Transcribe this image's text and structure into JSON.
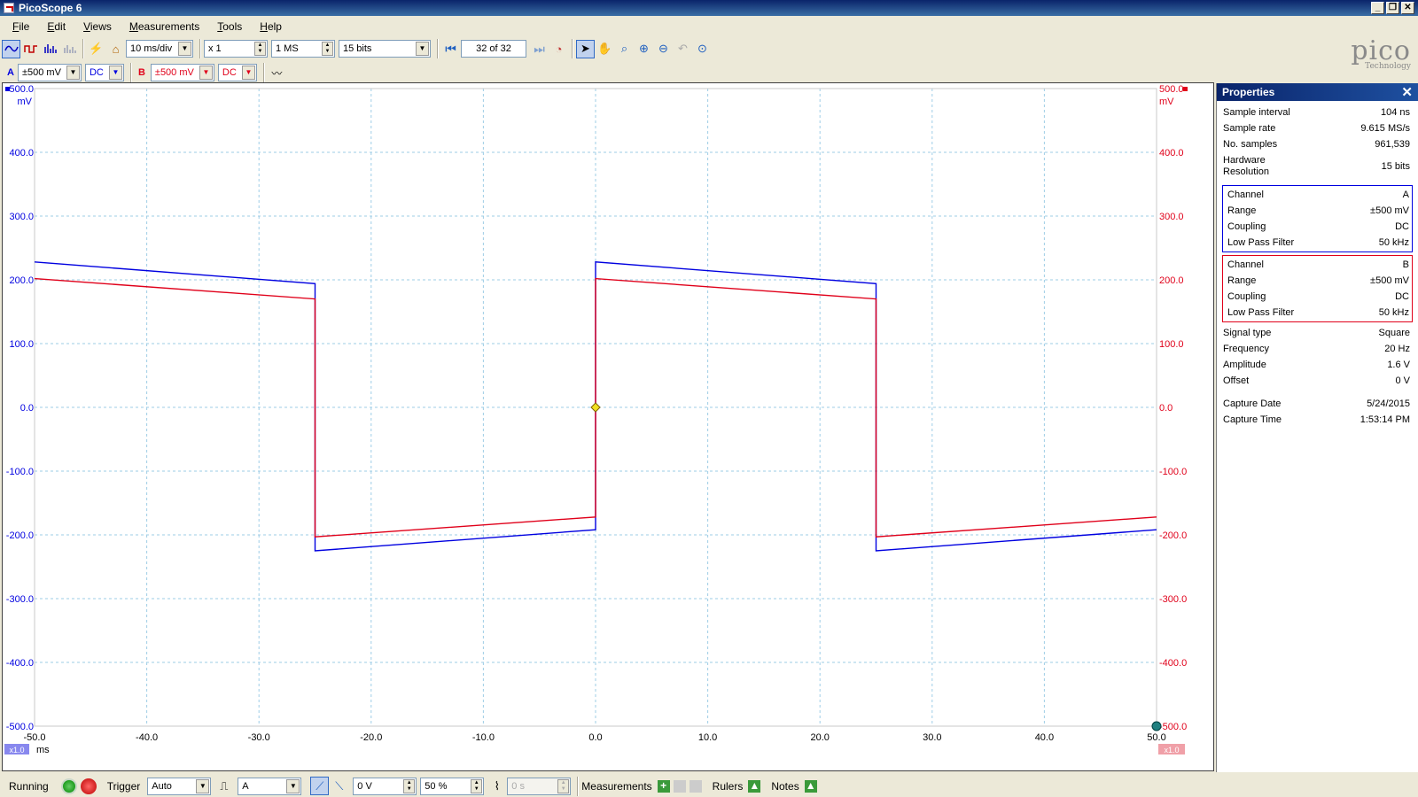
{
  "window": {
    "title": "PicoScope 6",
    "min": "_",
    "restore": "❐",
    "close": "✕"
  },
  "menu": [
    "File",
    "Edit",
    "Views",
    "Measurements",
    "Tools",
    "Help"
  ],
  "toolbar": {
    "timebase": "10 ms/div",
    "zoom": "x 1",
    "samples": "1 MS",
    "resolution": "15 bits",
    "buffer": "32 of 32"
  },
  "channels": {
    "a": {
      "letter": "A",
      "range": "±500 mV",
      "coupling": "DC",
      "color": "#0000e0"
    },
    "b": {
      "letter": "B",
      "range": "±500 mV",
      "coupling": "DC",
      "color": "#e0001a"
    }
  },
  "logo": {
    "name": "pico",
    "sub": "Technology"
  },
  "scope": {
    "unit_top": "mV",
    "x_unit": "ms",
    "zoom_badge": "x1.0"
  },
  "chart_data": {
    "type": "line",
    "xlabel": "ms",
    "ylabel": "mV",
    "xlim": [
      -50,
      50
    ],
    "ylim": [
      -500,
      500
    ],
    "x_ticks": [
      "-50.0",
      "-40.0",
      "-30.0",
      "-20.0",
      "-10.0",
      "0.0",
      "10.0",
      "20.0",
      "30.0",
      "40.0",
      "50.0"
    ],
    "y_ticks": [
      "500.0",
      "400.0",
      "300.0",
      "200.0",
      "100.0",
      "0.0",
      "-100.0",
      "-200.0",
      "-300.0",
      "-400.0",
      "-500.0"
    ],
    "grid": true,
    "series": [
      {
        "name": "A",
        "color": "#0000e0",
        "x": [
          -50,
          -25,
          -25,
          0,
          0,
          25,
          25,
          50
        ],
        "y": [
          228,
          194,
          -225,
          -192,
          228,
          194,
          -225,
          -192
        ]
      },
      {
        "name": "B",
        "color": "#e0001a",
        "x": [
          -50,
          -25,
          -25,
          0,
          0,
          25,
          25,
          50
        ],
        "y": [
          202,
          170,
          -203,
          -172,
          202,
          170,
          -203,
          -172
        ]
      }
    ],
    "trigger": {
      "x": 0,
      "y": 0
    }
  },
  "properties": {
    "title": "Properties",
    "general": [
      {
        "k": "Sample interval",
        "v": "104 ns"
      },
      {
        "k": "Sample rate",
        "v": "9.615 MS/s"
      },
      {
        "k": "No. samples",
        "v": "961,539"
      },
      {
        "k": "Hardware Resolution",
        "v": "15 bits"
      }
    ],
    "channel_a": [
      {
        "k": "Channel",
        "v": "A"
      },
      {
        "k": "Range",
        "v": "±500 mV"
      },
      {
        "k": "Coupling",
        "v": "DC"
      },
      {
        "k": "Low Pass Filter",
        "v": "50 kHz"
      }
    ],
    "channel_b": [
      {
        "k": "Channel",
        "v": "B"
      },
      {
        "k": "Range",
        "v": "±500 mV"
      },
      {
        "k": "Coupling",
        "v": "DC"
      },
      {
        "k": "Low Pass Filter",
        "v": "50 kHz"
      }
    ],
    "signal": [
      {
        "k": "Signal type",
        "v": "Square"
      },
      {
        "k": "Frequency",
        "v": "20 Hz"
      },
      {
        "k": "Amplitude",
        "v": "1.6 V"
      },
      {
        "k": "Offset",
        "v": "0 V"
      }
    ],
    "capture": [
      {
        "k": "Capture Date",
        "v": "5/24/2015"
      },
      {
        "k": "Capture Time",
        "v": "1:53:14 PM"
      }
    ]
  },
  "status": {
    "running": "Running",
    "trigger_label": "Trigger",
    "trigger_mode": "Auto",
    "trigger_source": "A",
    "trigger_level": "0 V",
    "pre_trigger": "50 %",
    "delay": "0 s",
    "measurements": "Measurements",
    "rulers": "Rulers",
    "notes": "Notes"
  }
}
